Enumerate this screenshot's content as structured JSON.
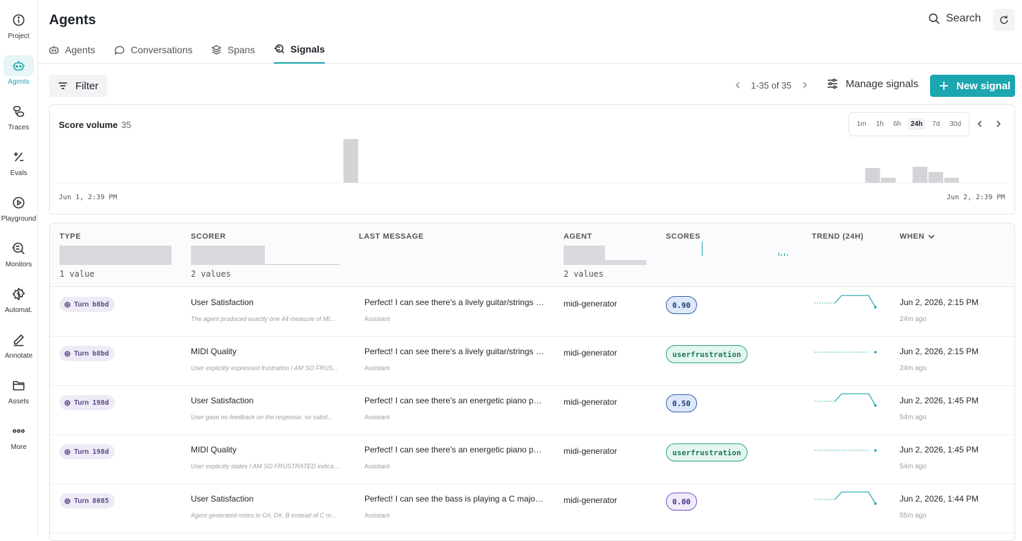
{
  "rail": [
    {
      "label": "Project",
      "icon": "info-icon"
    },
    {
      "label": "Agents",
      "icon": "robot-icon",
      "active": true
    },
    {
      "label": "Traces",
      "icon": "traces-icon"
    },
    {
      "label": "Evals",
      "icon": "plus-minus-icon"
    },
    {
      "label": "Playground",
      "icon": "play-icon"
    },
    {
      "label": "Monitors",
      "icon": "monitor-search-icon"
    },
    {
      "label": "Automat.",
      "icon": "automation-icon"
    },
    {
      "label": "Annotate",
      "icon": "pen-icon"
    },
    {
      "label": "Assets",
      "icon": "folder-icon"
    },
    {
      "label": "More",
      "icon": "more-dots-icon"
    }
  ],
  "header": {
    "title": "Agents",
    "search_label": "Search"
  },
  "tabs": [
    {
      "label": "Agents",
      "icon": "robot-icon"
    },
    {
      "label": "Conversations",
      "icon": "chat-icon"
    },
    {
      "label": "Spans",
      "icon": "layers-icon"
    },
    {
      "label": "Signals",
      "icon": "signals-icon",
      "active": true
    }
  ],
  "toolbar": {
    "filter_label": "Filter",
    "pager_text": "1-35 of 35",
    "manage_label": "Manage signals",
    "new_label": "New signal"
  },
  "volume": {
    "title": "Score volume",
    "count": "35",
    "ranges": [
      "1m",
      "1h",
      "6h",
      "24h",
      "7d",
      "30d"
    ],
    "active_range": "24h",
    "start_label": "Jun 1, 2:39 PM",
    "end_label": "Jun 2, 2:39 PM",
    "bar_heights": [
      {
        "slot": 18,
        "value": 9
      },
      {
        "slot": 51,
        "value": 3
      },
      {
        "slot": 52,
        "value": 1
      },
      {
        "slot": 54,
        "value": 3.3
      },
      {
        "slot": 55,
        "value": 2.2
      },
      {
        "slot": 56,
        "value": 1
      }
    ],
    "color": "#d3d4d7"
  },
  "table": {
    "headers": {
      "type": "TYPE",
      "scorer": "SCORER",
      "last_message": "LAST MESSAGE",
      "agent": "AGENT",
      "scores": "SCORES",
      "trend": "TREND (24H)",
      "when": "WHEN"
    },
    "facets": {
      "type_count": "1 value",
      "scorer_count": "2 values",
      "agent_count": "2 values"
    },
    "rows": [
      {
        "turn": "Turn",
        "turn_id": "b8bd",
        "scorer": "User Satisfaction",
        "rationale": "The agent produced exactly one 44 measure of MI...",
        "message": "Perfect! I can see there's a lively guitar/strings tr...",
        "role": "Assistant",
        "agent": "midi-generator",
        "score": "0.90",
        "score_style": "blue",
        "trend": [
          0,
          0,
          0,
          0,
          0.9,
          0.9,
          0.9,
          0.9,
          0.9,
          0.1
        ],
        "when": "Jun 2, 2026, 2:15 PM",
        "ago": "24m ago"
      },
      {
        "turn": "Turn",
        "turn_id": "b8bd",
        "scorer": "MIDI Quality",
        "rationale": "User explicitly expressed frustration I AM SO FRUS...",
        "message": "Perfect! I can see there's a lively guitar/strings tr...",
        "role": "Assistant",
        "agent": "midi-generator",
        "score": "userfrustration",
        "score_style": "green",
        "trend": [
          0,
          0,
          0,
          0,
          0,
          0,
          0,
          0,
          0,
          0
        ],
        "when": "Jun 2, 2026, 2:15 PM",
        "ago": "24m ago"
      },
      {
        "turn": "Turn",
        "turn_id": "198d",
        "scorer": "User Satisfaction",
        "rationale": "User gave no feedback on the response, so satisf...",
        "message": "Perfect! I can see there's an energetic piano part ...",
        "role": "Assistant",
        "agent": "midi-generator",
        "score": "0.50",
        "score_style": "blue",
        "trend": [
          0,
          0,
          0,
          0,
          0.9,
          0.9,
          0.9,
          0.9,
          0.9,
          0.1
        ],
        "when": "Jun 2, 2026, 1:45 PM",
        "ago": "54m ago"
      },
      {
        "turn": "Turn",
        "turn_id": "198d",
        "scorer": "MIDI Quality",
        "rationale": "User explicitly states I AM SO FRUSTRATED indicat...",
        "message": "Perfect! I can see there's an energetic piano part ...",
        "role": "Assistant",
        "agent": "midi-generator",
        "score": "userfrustration",
        "score_style": "green",
        "trend": [
          0,
          0,
          0,
          0,
          0,
          0,
          0,
          0,
          0,
          0
        ],
        "when": "Jun 2, 2026, 1:45 PM",
        "ago": "54m ago"
      },
      {
        "turn": "Turn",
        "turn_id": "8085",
        "scorer": "User Satisfaction",
        "rationale": "Agent generated notes in G#, D#, B instead of C m...",
        "message": "Perfect! I can see the bass is playing a C major pr...",
        "role": "Assistant",
        "agent": "midi-generator",
        "score": "0.00",
        "score_style": "purple",
        "trend": [
          0,
          0,
          0,
          0,
          0.9,
          0.9,
          0.9,
          0.9,
          0.9,
          0.1
        ],
        "when": "Jun 2, 2026, 1:44 PM",
        "ago": "55m ago"
      }
    ]
  },
  "colors": {
    "accent": "#1ba6b0",
    "border": "#e3e5e8"
  }
}
